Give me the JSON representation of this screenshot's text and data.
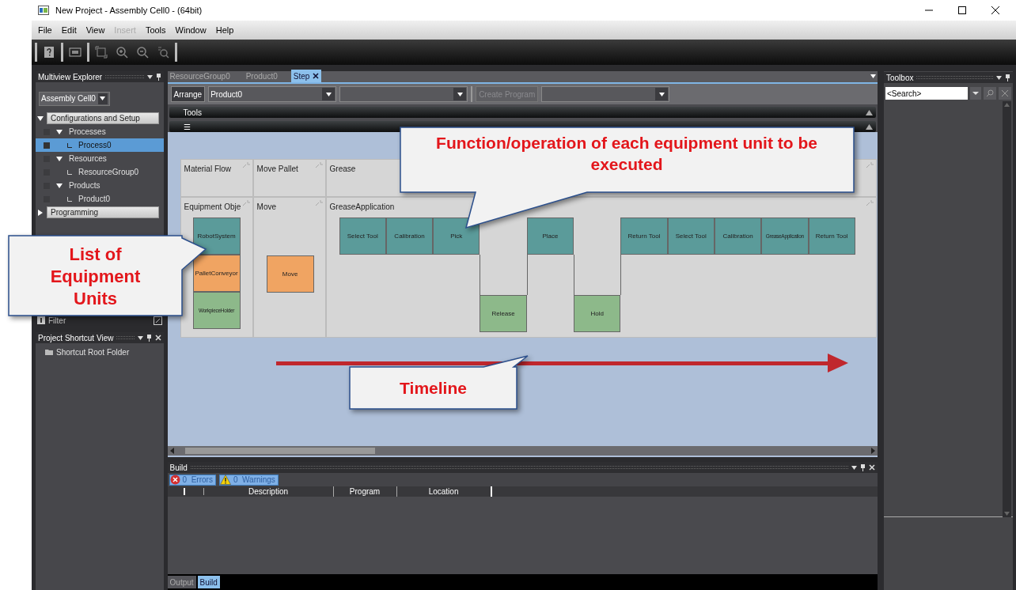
{
  "window": {
    "title": "New Project - Assembly Cell0 -  (64bit)"
  },
  "menu": [
    {
      "label": "File",
      "disabled": false
    },
    {
      "label": "Edit",
      "disabled": false
    },
    {
      "label": "View",
      "disabled": false
    },
    {
      "label": "Insert",
      "disabled": true
    },
    {
      "label": "Tools",
      "disabled": false
    },
    {
      "label": "Window",
      "disabled": false
    },
    {
      "label": "Help",
      "disabled": false
    }
  ],
  "explorer": {
    "title": "Multiview Explorer",
    "selector": "Assembly Cell0",
    "tree": [
      {
        "label": "Configurations and Setup",
        "kind": "section",
        "expanded": true,
        "selected": false,
        "children": [
          {
            "label": "Processes",
            "kind": "item",
            "expanded": true,
            "selected": false,
            "children": [
              {
                "label": "Process0",
                "kind": "item",
                "selected": true
              }
            ]
          },
          {
            "label": "Resources",
            "kind": "item",
            "expanded": true,
            "selected": false,
            "children": [
              {
                "label": "ResourceGroup0",
                "kind": "item",
                "selected": false
              }
            ]
          },
          {
            "label": "Products",
            "kind": "item",
            "expanded": true,
            "selected": false,
            "children": [
              {
                "label": "Product0",
                "kind": "item",
                "selected": false
              }
            ]
          }
        ]
      },
      {
        "label": "Programming",
        "kind": "section",
        "expanded": false,
        "selected": false
      }
    ],
    "filter": "Filter"
  },
  "shortcut_view": {
    "title": "Project Shortcut View",
    "items": [
      "Shortcut Root Folder"
    ]
  },
  "editor": {
    "tabs": [
      {
        "label": "ResourceGroup0",
        "selected": false
      },
      {
        "label": "Product0",
        "selected": false
      },
      {
        "label": "Step",
        "selected": true
      }
    ],
    "arrange": "Arrange",
    "product": "Product0",
    "create_program": {
      "label": "Create Program",
      "disabled": true
    },
    "sections": [
      "Tools",
      "☰"
    ],
    "diagram": {
      "header_row": [
        "Material Flow",
        "Move Pallet",
        "Grease"
      ],
      "equipment_lane": {
        "label": "Equipment Obje",
        "units": [
          {
            "label": "RobotSystem",
            "color": "#5b9b9a"
          },
          {
            "label": "PalletConveyor",
            "color": "#f0a462"
          },
          {
            "label": "WorkpieceHolder",
            "color": "#8db98a"
          }
        ]
      },
      "move_lane": {
        "label": "Move",
        "steps": [
          {
            "label": "Move",
            "color": "#f0a462"
          }
        ]
      },
      "grease_lane": {
        "label": "GreaseApplication",
        "steps": [
          {
            "label": "Select Tool",
            "kind": "upper",
            "color": "#5b9b9a"
          },
          {
            "label": "Calibration",
            "kind": "upper",
            "color": "#5b9b9a"
          },
          {
            "label": "Pick",
            "kind": "upper",
            "color": "#5b9b9a"
          },
          {
            "label": "Release",
            "kind": "lower",
            "color": "#8db98a"
          },
          {
            "label": "Place",
            "kind": "upper",
            "color": "#5b9b9a"
          },
          {
            "label": "Hold",
            "kind": "lower",
            "color": "#8db98a"
          },
          {
            "label": "Return Tool",
            "kind": "upper",
            "color": "#5b9b9a"
          },
          {
            "label": "Select Tool",
            "kind": "upper",
            "color": "#5b9b9a"
          },
          {
            "label": "Calibration",
            "kind": "upper",
            "color": "#5b9b9a"
          },
          {
            "label": "GreaseApplication",
            "kind": "upper",
            "color": "#5b9b9a"
          },
          {
            "label": "Return Tool",
            "kind": "upper",
            "color": "#5b9b9a"
          }
        ]
      }
    }
  },
  "build": {
    "title": "Build",
    "errors": "0  Errors",
    "warnings": "0  Warnings",
    "columns": [
      "Description",
      "Program",
      "Location"
    ]
  },
  "bottom_tabs": [
    {
      "label": "Output",
      "selected": false
    },
    {
      "label": "Build",
      "selected": true
    }
  ],
  "toolbox": {
    "title": "Toolbox",
    "search_placeholder": "<Search>"
  },
  "callouts": [
    {
      "text": "Function/operation of each equipment unit to be executed"
    },
    {
      "text": "List of Equipment Units"
    },
    {
      "text": "Timeline"
    }
  ]
}
